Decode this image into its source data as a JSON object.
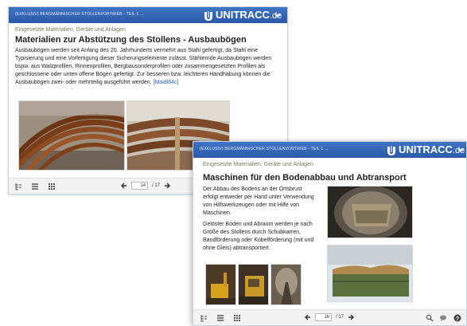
{
  "slide1": {
    "course_title": "(EXKLUSIV) BERGMÄNNISCHER STOLLENVORTRIEB - TEIL 1 ...",
    "brand": {
      "name": "UNITRACC",
      "suffix": ".de"
    },
    "breadcrumb": "Eingesetzte Materialien, Geräte und Anlagen",
    "title": "Materialien zur Abstützung des Stollens - Ausbaubögen",
    "body": "Ausbaubögen werden seit Anfang des 20. Jahrhunderts vermehrt aus Stahl gefertigt, da Stahl eine Typisierung und eine Vorfertigung dieser Sicherungselemente zulässt. Stählernde Ausbaubögen werden bspw. aus Walzprofilen, Rinnenprofilen, Bergbausonderprofilen oder zusammengesetzten Profilen als geschlossene oder unten offene Bögen gefertigt. Zur besseren bzw. leichteren Handhabung können die Ausbaubögen zwei- oder mehrteilig ausgeführt werden.",
    "citation": "[Maidl84c]",
    "pager": {
      "current": "14",
      "total": "/ 17"
    }
  },
  "slide2": {
    "course_title": "(EXKLUSIV) BERGMÄNNISCHER STOLLENVORTRIEB - TEIL 1 ...",
    "brand": {
      "name": "UNITRACC",
      "suffix": ".de"
    },
    "breadcrumb": "Eingesetzte Materialien, Geräte und Anlagen",
    "title": "Maschinen für den Bodenabbau und Abtransport",
    "paragraph1": "Der Abbau des Bodens an der Ortsbrust erfolgt entweder per Hand unter Verwendung von Hilfswerkzeugen oder mit Hilfe von Maschinen.",
    "paragraph2": "Gelöster Boden und Abraum werden je nach Größe des Stollens durch Schubkarren, Bandförderung oder Kübelförderung (mit und ohne Gleis) abtransportiert.",
    "pager": {
      "current": "16",
      "total": "/ 17"
    }
  },
  "colors": {
    "header_blue": "#2f62b2",
    "breadcrumb_green": "#6d7f55",
    "citation_blue": "#2a62b8"
  },
  "icons": [
    "unitracc-logo-icon",
    "chevron-down-icon",
    "outline-icon",
    "list-icon",
    "grid-icon",
    "prev-arrow-icon",
    "next-arrow-icon",
    "search-icon",
    "comment-icon",
    "help-icon"
  ]
}
